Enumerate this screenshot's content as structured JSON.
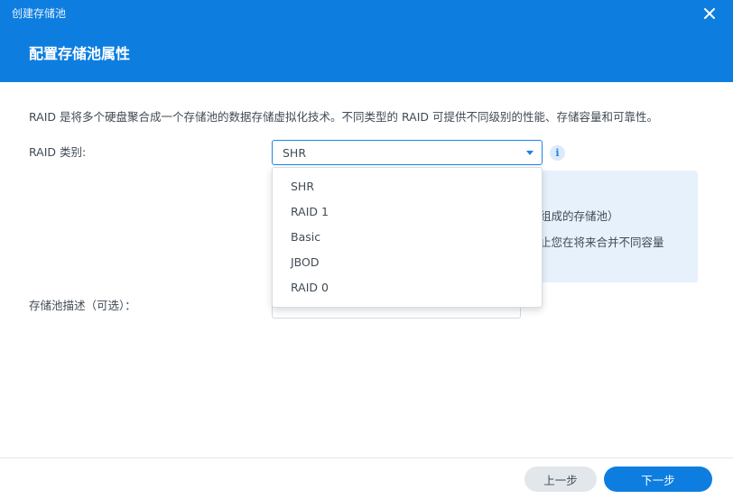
{
  "window": {
    "title": "创建存储池",
    "step_title": "配置存储池属性"
  },
  "form": {
    "description": "RAID 是将多个硬盘聚合成一个存储池的数据存储虚拟化技术。不同类型的 RAID 可提供不同级别的性能、存储容量和可靠性。",
    "raid_label": "RAID 类别:",
    "raid_selected": "SHR",
    "pool_desc_label": "存储池描述（可选）：",
    "pool_desc_value": ""
  },
  "dropdown": {
    "options": [
      "SHR",
      "RAID 1",
      "Basic",
      "JBOD",
      "RAID 0"
    ]
  },
  "info_panel": {
    "line1": "组成的存储池）",
    "line2": "止您在将来合并不同容量"
  },
  "footer": {
    "prev_label": "上一步",
    "next_label": "下一步"
  },
  "icons": {
    "close": "close-icon",
    "info": "info-icon",
    "caret": "chevron-down-icon"
  },
  "colors": {
    "accent": "#0d7ee0",
    "panel": "#e6f1fc"
  }
}
